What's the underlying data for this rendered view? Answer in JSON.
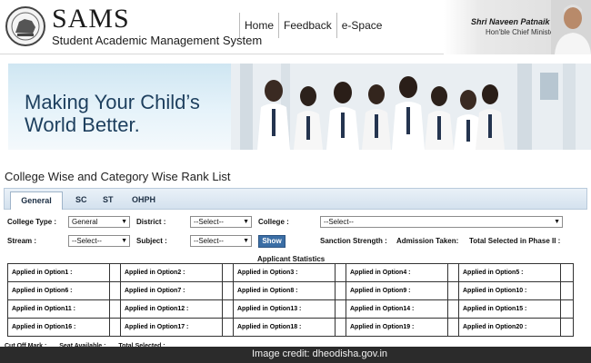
{
  "header": {
    "brand_title": "SAMS",
    "brand_subtitle": "Student Academic Management System",
    "nav": [
      "Home",
      "Feedback",
      "e-Space"
    ],
    "cm_name": "Shri Naveen Patnaik",
    "cm_title": "Hon'ble Chief Minister"
  },
  "banner": {
    "line1": "Making Your Child’s",
    "line2": "World Better."
  },
  "page_title": "College Wise and Category Wise Rank List",
  "tabs": [
    "General",
    "SC",
    "ST",
    "OHPH"
  ],
  "filters": {
    "college_type_label": "College Type :",
    "college_type_value": "General",
    "district_label": "District :",
    "district_value": "--Select--",
    "college_label": "College :",
    "college_value": "--Select--",
    "stream_label": "Stream :",
    "stream_value": "--Select--",
    "subject_label": "Subject :",
    "subject_value": "--Select--",
    "show_label": "Show",
    "sanction_label": "Sanction Strength :",
    "admission_label": "Admission Taken:",
    "selected_label": "Total Selected in Phase II :"
  },
  "stats": {
    "title": "Applicant Statistics",
    "rows": [
      [
        "Applied in Option1 :",
        "Applied in Option2 :",
        "Applied in Option3 :",
        "Applied in Option4 :",
        "Applied in Option5 :"
      ],
      [
        "Applied in Option6 :",
        "Applied in Option7 :",
        "Applied in Option8 :",
        "Applied in Option9 :",
        "Applied in Option10 :"
      ],
      [
        "Applied in Option11 :",
        "Applied in Option12 :",
        "Applied in Option13 :",
        "Applied in Option14 :",
        "Applied in Option15 :"
      ],
      [
        "Applied in Option16 :",
        "Applied in Option17 :",
        "Applied in Option18 :",
        "Applied in Option19 :",
        "Applied in Option20 :"
      ]
    ]
  },
  "bottom": {
    "cutoff": "Cut Off Mark :",
    "seat": "Seat Available :",
    "total": "Total Selected :"
  },
  "credit": "Image credit: dheodisha.gov.in",
  "colors": {
    "tab_bar": "#d4e1ee",
    "show_button": "#3b6ea5",
    "banner_text": "#1d3f5e",
    "credit_bar": "#2b2b2b"
  }
}
